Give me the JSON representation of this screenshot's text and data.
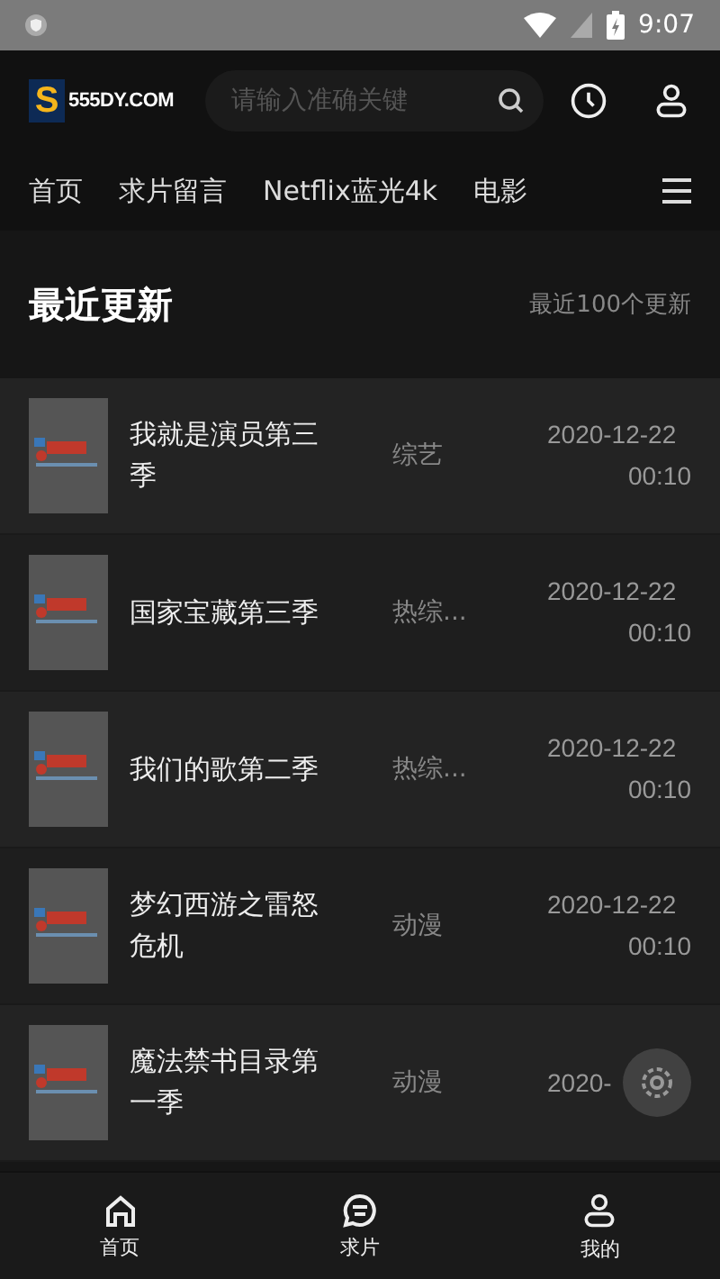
{
  "status_bar": {
    "time": "9:07"
  },
  "header": {
    "logo_letter": "S",
    "logo_text": "555DY.COM",
    "search": {
      "placeholder": "请输入准确关键"
    }
  },
  "nav_tabs": [
    "首页",
    "求片留言",
    "Netflix蓝光4k",
    "电影"
  ],
  "section": {
    "title": "最近更新",
    "more": "最近100个更新"
  },
  "rows": [
    {
      "title": "我就是演员第三季",
      "category": "综艺",
      "date": "2020-12-22",
      "time": "00:10"
    },
    {
      "title": "国家宝藏第三季",
      "category": "热综...",
      "date": "2020-12-22",
      "time": "00:10"
    },
    {
      "title": "我们的歌第二季",
      "category": "热综...",
      "date": "2020-12-22",
      "time": "00:10"
    },
    {
      "title": "梦幻西游之雷怒危机",
      "category": "动漫",
      "date": "2020-12-22",
      "time": "00:10"
    },
    {
      "title": "魔法禁书目录第一季",
      "category": "动漫",
      "date": "2020-"
    }
  ],
  "bottom_nav": [
    {
      "label": "首页",
      "kind": "home"
    },
    {
      "label": "求片",
      "kind": "chat"
    },
    {
      "label": "我的",
      "kind": "user"
    }
  ]
}
